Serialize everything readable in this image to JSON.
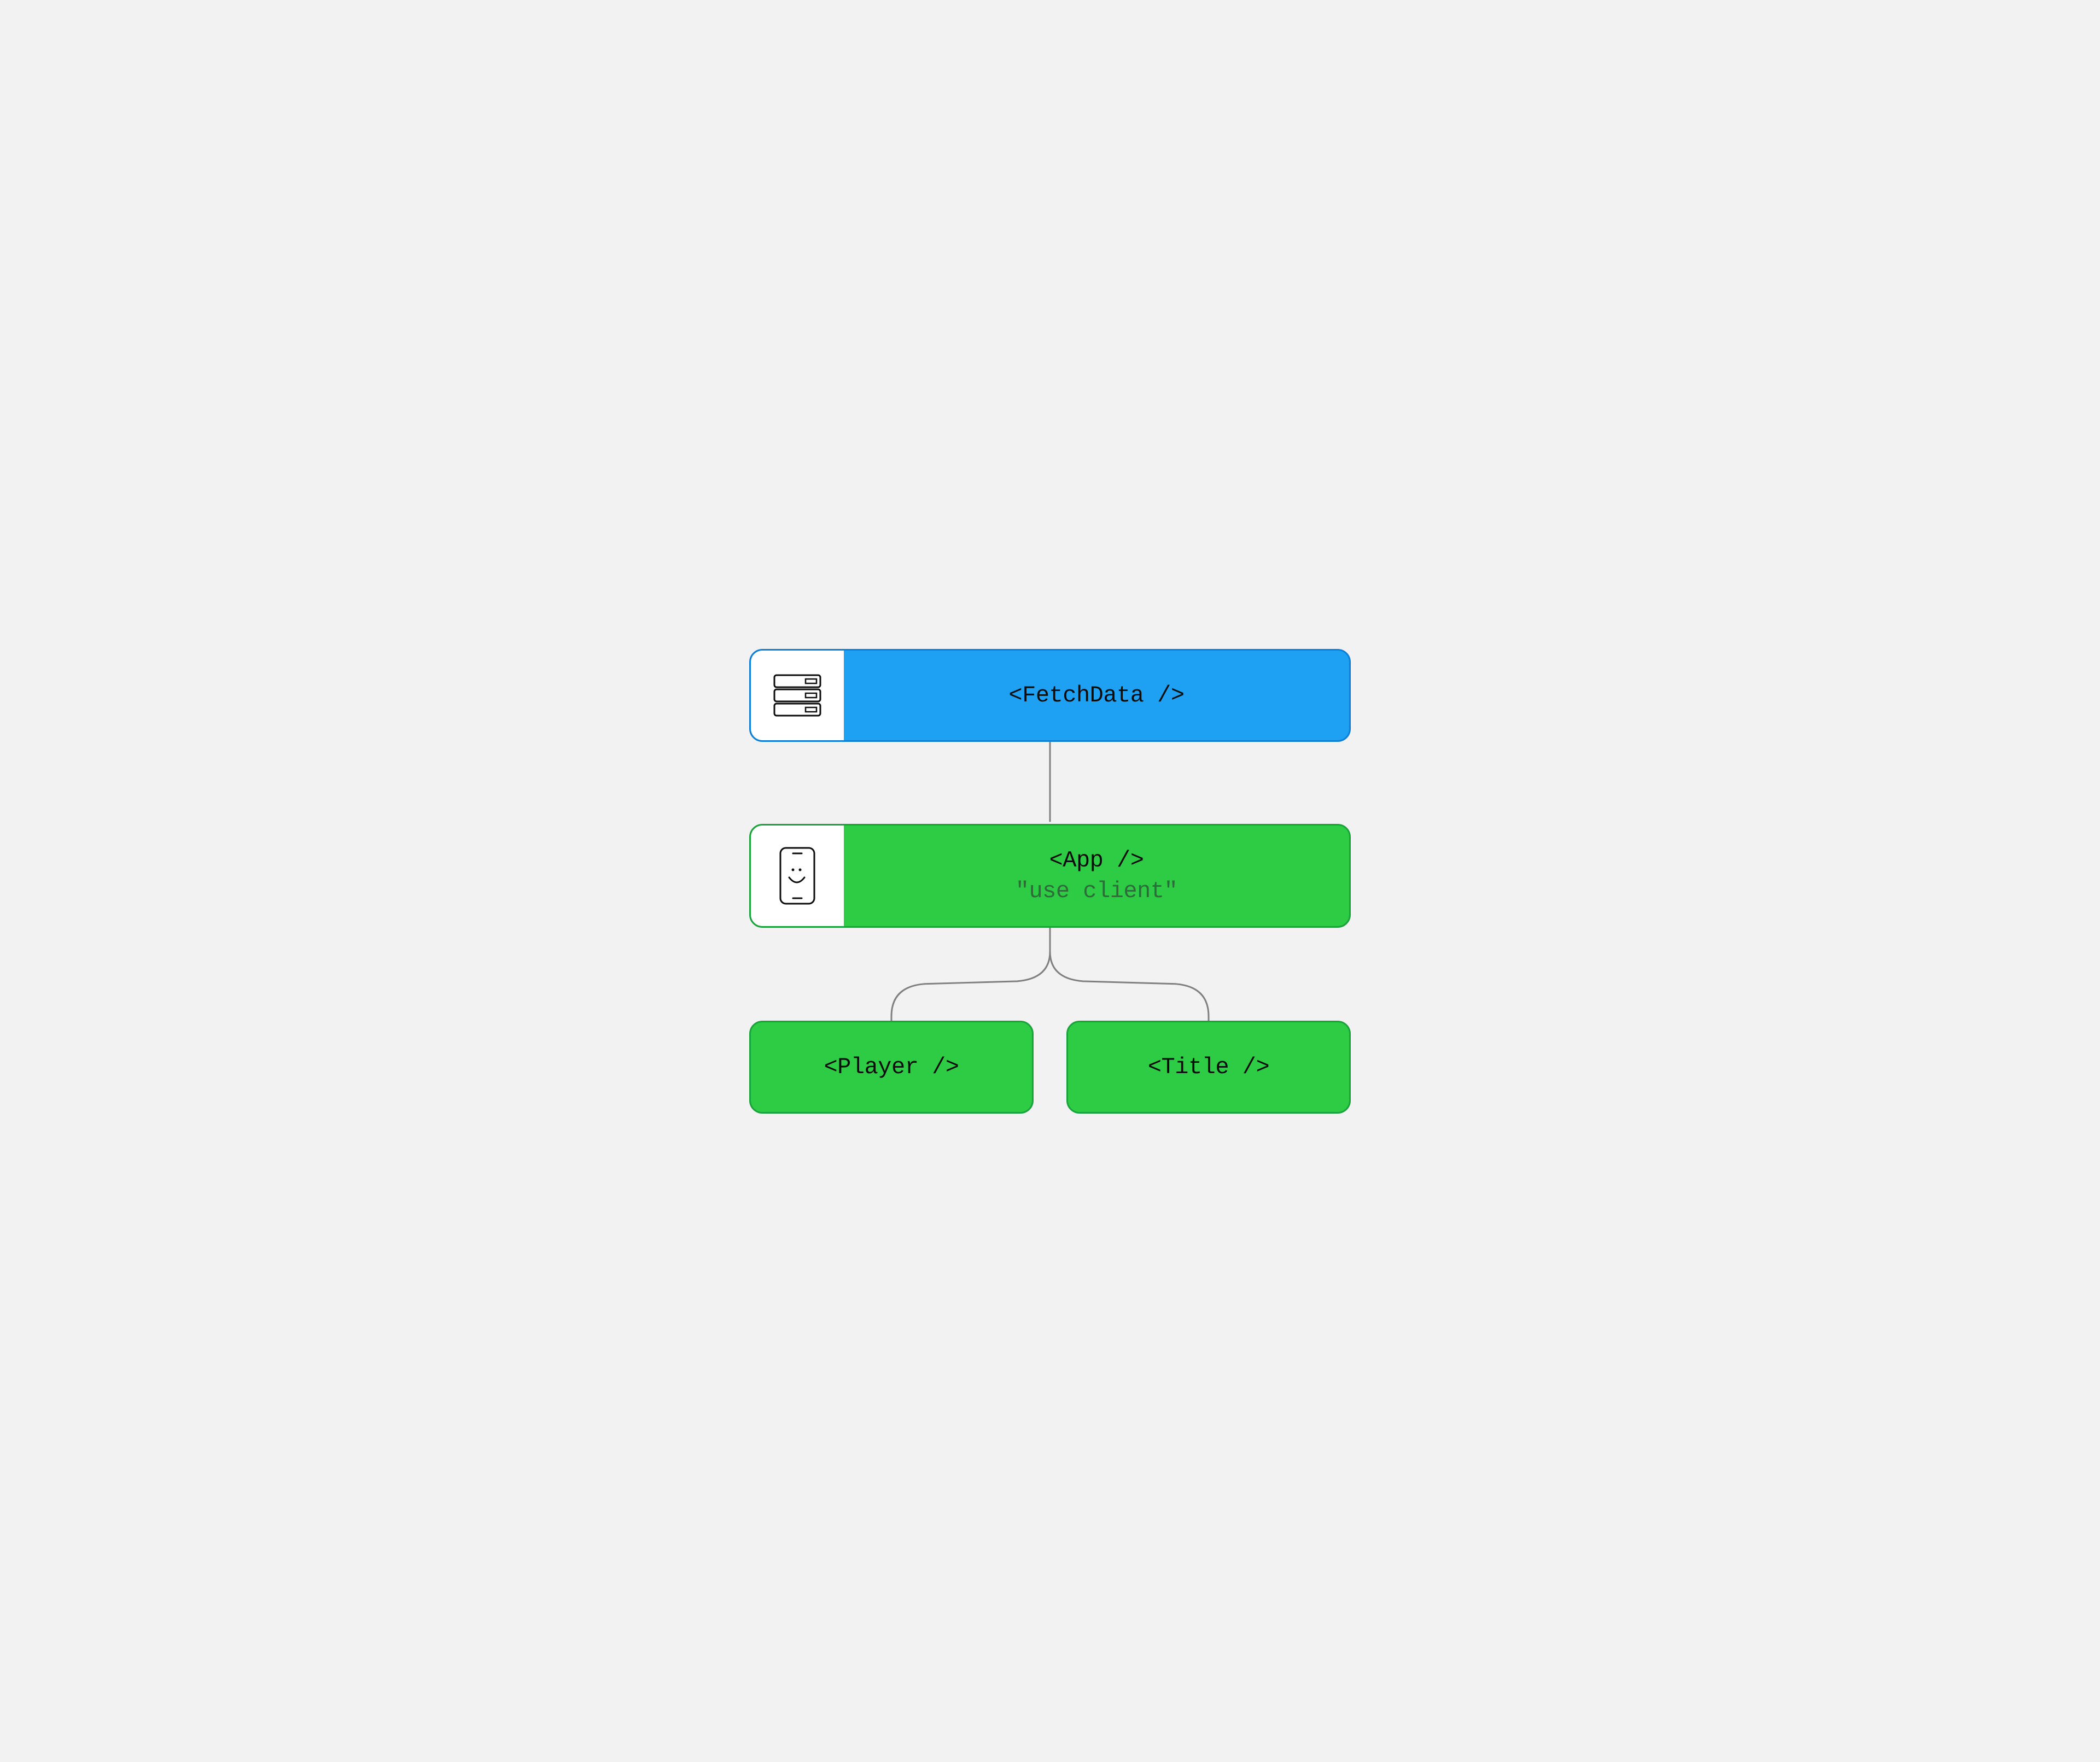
{
  "nodes": {
    "server": {
      "label": "<FetchData />",
      "icon": "server-icon"
    },
    "client": {
      "label": "<App />",
      "subtitle": "\"use client\"",
      "icon": "phone-icon"
    },
    "children": [
      {
        "label": "<Player />"
      },
      {
        "label": "<Title />"
      }
    ]
  },
  "colors": {
    "server_border": "#0d7fd6",
    "server_fill": "#1ea1f3",
    "client_border": "#1aa33a",
    "client_fill": "#2ecc45",
    "background": "#f2f2f2",
    "text": "#0c0c0c",
    "subtitle": "#2d6b38",
    "connector": "#808080"
  }
}
